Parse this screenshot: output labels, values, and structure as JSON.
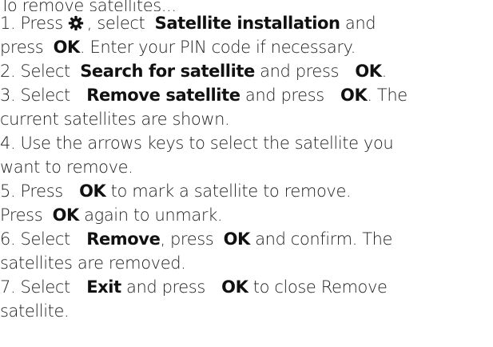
{
  "lines": {
    "l0": {
      "text": "To remove satellites..."
    },
    "l1": {
      "a": "1. Press",
      "b": ", select",
      "c": "Satellite installation",
      "d": "and"
    },
    "l2": {
      "a": "press",
      "b": "OK",
      "c": ". Enter your PIN code if necessary."
    },
    "l3": {
      "a": "2. Select",
      "b": "Search for satellite",
      "c": "and press",
      "d": "OK",
      "e": "."
    },
    "l4": {
      "a": "3. Select",
      "b": "Remove satellite",
      "c": "and press",
      "d": "OK",
      "e": ". The"
    },
    "l5": {
      "a": "current satellites are shown."
    },
    "l6": {
      "a": "4. Use the arrows keys to select the satellite you"
    },
    "l7": {
      "a": "want to remove."
    },
    "l8": {
      "a": "5. Press",
      "b": "OK",
      "c": "to mark a satellite to remove."
    },
    "l9": {
      "a": "Press",
      "b": "OK",
      "c": "again to unmark."
    },
    "l10": {
      "a": "6. Select",
      "b": "Remove",
      "c": ", press",
      "d": "OK",
      "e": "and confirm. The"
    },
    "l11": {
      "a": "satellites are removed."
    },
    "l12": {
      "a": "7. Select",
      "b": "Exit",
      "c": "and press",
      "d": "OK",
      "e": "to close Remove"
    },
    "l13": {
      "a": "satellite."
    }
  },
  "icons": {
    "settings": "gear-icon"
  },
  "colors": {
    "text": "#222222",
    "emphasis": "#111111",
    "background": "#ffffff"
  }
}
